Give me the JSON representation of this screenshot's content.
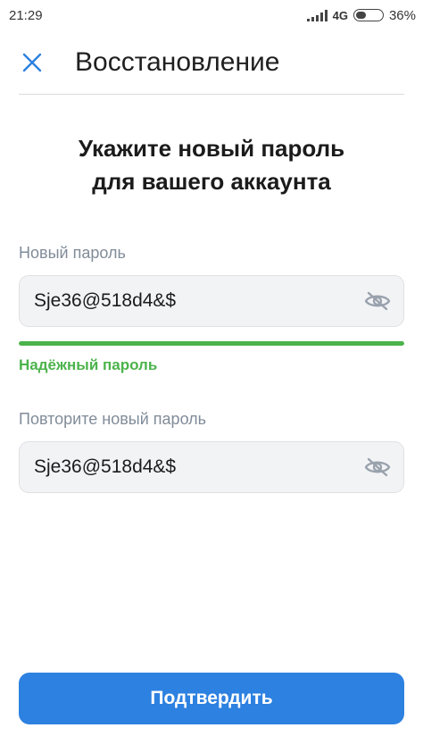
{
  "status_bar": {
    "time": "21:29",
    "network": "4G",
    "battery": "36%",
    "battery_level": 0.36
  },
  "header": {
    "title": "Восстановление",
    "close_icon": "close-icon"
  },
  "heading": {
    "line1": "Укажите новый пароль",
    "line2": "для вашего аккаунта"
  },
  "new_password": {
    "label": "Новый пароль",
    "value": "Sje36@518d4&$",
    "toggle_icon": "eye-off-icon"
  },
  "strength": {
    "text": "Надёжный пароль",
    "level": 1.0,
    "color": "#4bb34b"
  },
  "repeat_password": {
    "label": "Повторите новый пароль",
    "value": "Sje36@518d4&$",
    "toggle_icon": "eye-off-icon"
  },
  "confirm_button": {
    "label": "Подтвердить",
    "color": "#2d81e0"
  },
  "colors": {
    "accent": "#2d81e0",
    "success": "#4bb34b",
    "label": "#818c99"
  }
}
